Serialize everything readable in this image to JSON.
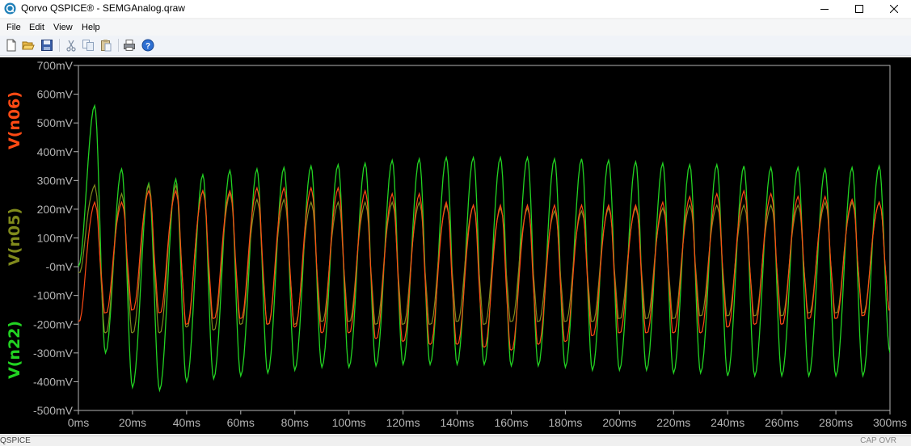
{
  "window": {
    "title": "Qorvo QSPICE® - SEMGAnalog.qraw"
  },
  "menu": {
    "items": [
      "File",
      "Edit",
      "View",
      "Help"
    ]
  },
  "toolbar": {
    "buttons": [
      "new-icon",
      "open-icon",
      "save-icon",
      "cut-icon",
      "copy-icon",
      "paste-icon",
      "print-icon",
      "help-icon"
    ]
  },
  "status": {
    "left": "QSPICE",
    "right": "CAP  OVR"
  },
  "colors": {
    "background": "#000000",
    "axis": "#b4b4b4",
    "n06": "#ff4a14",
    "n05": "#808a1c",
    "n22": "#22d322"
  },
  "chart_data": {
    "type": "line",
    "xlabel": "",
    "ylabel": "",
    "xlim": [
      0,
      300
    ],
    "ylim": [
      -500,
      700
    ],
    "x_ticks": [
      0,
      20,
      40,
      60,
      80,
      100,
      120,
      140,
      160,
      180,
      200,
      220,
      240,
      260,
      280,
      300
    ],
    "x_tick_labels": [
      "0ms",
      "20ms",
      "40ms",
      "60ms",
      "80ms",
      "100ms",
      "120ms",
      "140ms",
      "160ms",
      "180ms",
      "200ms",
      "220ms",
      "240ms",
      "260ms",
      "280ms",
      "300ms"
    ],
    "y_ticks": [
      700,
      600,
      500,
      400,
      300,
      200,
      100,
      0,
      -100,
      -200,
      -300,
      -400,
      -500
    ],
    "y_tick_labels": [
      "700mV",
      "600mV",
      "500mV",
      "400mV",
      "300mV",
      "200mV",
      "100mV",
      "-0mV",
      "-100mV",
      "-200mV",
      "-300mV",
      "-400mV",
      "-500mV"
    ],
    "grid": false,
    "legend": "left-vertical",
    "series": [
      {
        "name": "V(n06)",
        "color": "#ff4a14",
        "x": [
          0,
          6,
          10,
          16,
          20,
          26,
          30,
          36,
          40,
          46,
          50,
          56,
          60,
          66,
          70,
          76,
          80,
          86,
          90,
          96,
          100,
          106,
          110,
          116,
          120,
          126,
          130,
          136,
          140,
          146,
          150,
          156,
          160,
          166,
          170,
          176,
          180,
          186,
          190,
          196,
          200,
          206,
          210,
          216,
          220,
          226,
          230,
          236,
          240,
          246,
          250,
          256,
          260,
          266,
          270,
          276,
          280,
          286,
          290,
          296,
          300
        ],
        "values": [
          -190,
          230,
          -160,
          230,
          -150,
          270,
          -160,
          270,
          -200,
          270,
          -180,
          270,
          -180,
          280,
          -200,
          280,
          -210,
          280,
          -230,
          280,
          -230,
          270,
          -250,
          260,
          -260,
          260,
          -270,
          230,
          -270,
          220,
          -280,
          220,
          -290,
          220,
          -270,
          220,
          -260,
          220,
          -240,
          220,
          -230,
          220,
          -230,
          230,
          -230,
          250,
          -230,
          260,
          -210,
          270,
          -200,
          260,
          -200,
          250,
          -180,
          250,
          -180,
          240,
          -170,
          230,
          -150
        ]
      },
      {
        "name": "V(n05)",
        "color": "#808a1c",
        "x": [
          0,
          6,
          10,
          16,
          20,
          26,
          30,
          36,
          40,
          46,
          50,
          56,
          60,
          66,
          70,
          76,
          80,
          86,
          90,
          96,
          100,
          106,
          110,
          116,
          120,
          126,
          130,
          136,
          140,
          146,
          150,
          156,
          160,
          166,
          170,
          176,
          180,
          186,
          190,
          196,
          200,
          206,
          210,
          216,
          220,
          226,
          230,
          236,
          240,
          246,
          250,
          256,
          260,
          266,
          270,
          276,
          280,
          286,
          290,
          296,
          300
        ],
        "values": [
          -20,
          290,
          -230,
          260,
          -230,
          290,
          -230,
          290,
          -210,
          270,
          -220,
          260,
          -200,
          240,
          -200,
          240,
          -200,
          230,
          -190,
          230,
          -190,
          230,
          -200,
          230,
          -200,
          230,
          -200,
          220,
          -190,
          220,
          -200,
          210,
          -190,
          210,
          -190,
          200,
          -190,
          200,
          -190,
          210,
          -180,
          210,
          -180,
          210,
          -180,
          220,
          -170,
          220,
          -170,
          220,
          -170,
          220,
          -170,
          220,
          -160,
          230,
          -160,
          230,
          -160,
          230,
          -150
        ]
      },
      {
        "name": "V(n22)",
        "color": "#22d322",
        "x": [
          0,
          6,
          10,
          16,
          20,
          26,
          30,
          36,
          40,
          46,
          50,
          56,
          60,
          66,
          70,
          76,
          80,
          86,
          90,
          96,
          100,
          106,
          110,
          116,
          120,
          126,
          130,
          136,
          140,
          146,
          150,
          156,
          160,
          166,
          170,
          176,
          180,
          186,
          190,
          196,
          200,
          206,
          210,
          216,
          220,
          226,
          230,
          236,
          240,
          246,
          250,
          256,
          260,
          266,
          270,
          276,
          280,
          286,
          290,
          296,
          300
        ],
        "values": [
          0,
          560,
          -300,
          340,
          -420,
          290,
          -430,
          305,
          -400,
          320,
          -390,
          335,
          -380,
          340,
          -370,
          345,
          -360,
          350,
          -350,
          355,
          -350,
          360,
          -345,
          370,
          -340,
          375,
          -340,
          380,
          -340,
          380,
          -340,
          380,
          -345,
          380,
          -345,
          375,
          -350,
          375,
          -360,
          370,
          -360,
          365,
          -360,
          360,
          -370,
          355,
          -370,
          355,
          -380,
          350,
          -380,
          345,
          -380,
          345,
          -380,
          340,
          -380,
          345,
          -380,
          350,
          -300
        ]
      }
    ]
  }
}
